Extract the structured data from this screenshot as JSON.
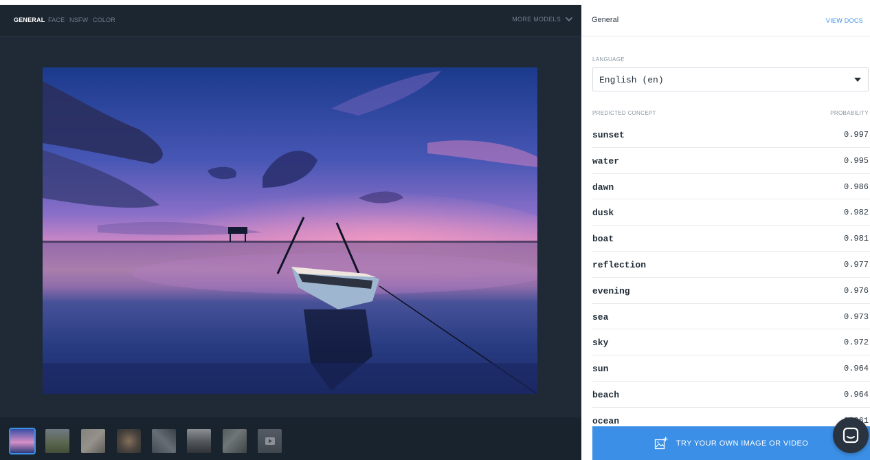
{
  "models": {
    "tabs": [
      {
        "label": "GENERAL",
        "active": true
      },
      {
        "label": "FACE",
        "active": false
      },
      {
        "label": "NSFW",
        "active": false
      },
      {
        "label": "COLOR",
        "active": false
      }
    ],
    "more_label": "MORE MODELS"
  },
  "main_image": {
    "subject": "boat on calm water at sunset"
  },
  "thumbnails": [
    {
      "name": "sunset-boat",
      "active": true
    },
    {
      "name": "field-landscape",
      "active": false
    },
    {
      "name": "portrait",
      "active": false
    },
    {
      "name": "food-plate",
      "active": false
    },
    {
      "name": "street-scene",
      "active": false
    },
    {
      "name": "interior",
      "active": false
    },
    {
      "name": "aerial-texture",
      "active": false
    },
    {
      "name": "video",
      "active": false
    }
  ],
  "panel": {
    "title": "General",
    "docs_label": "VIEW DOCS",
    "language_label": "LANGUAGE",
    "language_value": "English (en)",
    "col_concept": "PREDICTED CONCEPT",
    "col_probability": "PROBABILITY",
    "concepts": [
      {
        "name": "sunset",
        "prob": "0.997"
      },
      {
        "name": "water",
        "prob": "0.995"
      },
      {
        "name": "dawn",
        "prob": "0.986"
      },
      {
        "name": "dusk",
        "prob": "0.982"
      },
      {
        "name": "boat",
        "prob": "0.981"
      },
      {
        "name": "reflection",
        "prob": "0.977"
      },
      {
        "name": "evening",
        "prob": "0.976"
      },
      {
        "name": "sea",
        "prob": "0.973"
      },
      {
        "name": "sky",
        "prob": "0.972"
      },
      {
        "name": "sun",
        "prob": "0.964"
      },
      {
        "name": "beach",
        "prob": "0.964"
      },
      {
        "name": "ocean",
        "prob": "0.961"
      }
    ],
    "try_label": "TRY YOUR OWN IMAGE OR VIDEO"
  },
  "colors": {
    "accent": "#3b8fe6",
    "dark_bg": "#1f2a36"
  },
  "icons": {
    "more": "chevron-down-icon",
    "caret": "caret-down-icon",
    "try": "add-image-icon",
    "chat": "chat-icon"
  }
}
